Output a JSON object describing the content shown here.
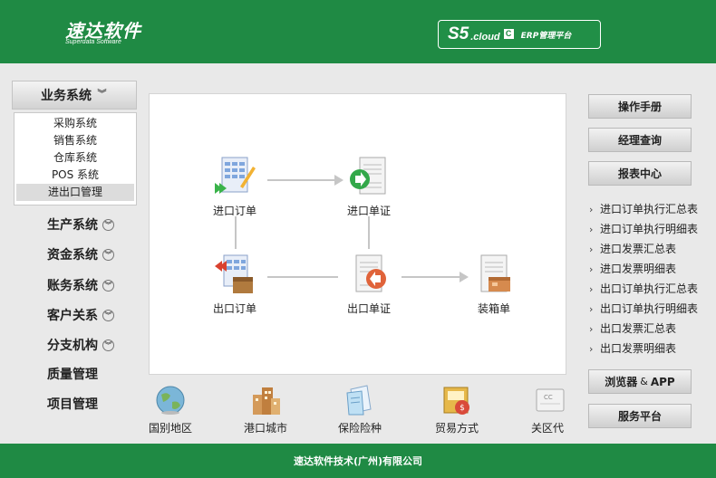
{
  "header": {
    "logo_main": "速达软件",
    "logo_sub": "Superdata Software",
    "badge_s5": "S5",
    "badge_cloud": ".cloud",
    "badge_c": "C",
    "badge_erp": "ERP管理平台"
  },
  "sidebar": {
    "business_system": "业务系统",
    "submenu": [
      "采购系统",
      "销售系统",
      "仓库系统",
      "POS 系统",
      "进出口管理"
    ],
    "items": [
      {
        "label": "生产系统",
        "chevron": true
      },
      {
        "label": "资金系统",
        "chevron": true
      },
      {
        "label": "账务系统",
        "chevron": true
      },
      {
        "label": "客户关系",
        "chevron": true
      },
      {
        "label": "分支机构",
        "chevron": true
      },
      {
        "label": "质量管理",
        "chevron": false
      },
      {
        "label": "项目管理",
        "chevron": false
      }
    ]
  },
  "flow": {
    "import_order": "进口订单",
    "import_doc": "进口单证",
    "export_order": "出口订单",
    "export_doc": "出口单证",
    "packing_list": "装箱单"
  },
  "quick": [
    "国别地区",
    "港口城市",
    "保险险种",
    "贸易方式",
    "关区代"
  ],
  "right": {
    "manual": "操作手册",
    "manager_query": "经理查询",
    "report_center": "报表中心",
    "reports": [
      "进口订单执行汇总表",
      "进口订单执行明细表",
      "进口发票汇总表",
      "进口发票明细表",
      "出口订单执行汇总表",
      "出口订单执行明细表",
      "出口发票汇总表",
      "出口发票明细表"
    ],
    "browser": "浏览器",
    "amp": "&",
    "app": "APP",
    "service": "服务平台"
  },
  "footer": {
    "company": "速达软件技术(广州)有限公司"
  },
  "colors": {
    "brand_green": "#1f8a44",
    "panel_bg": "#ffffff",
    "page_bg": "#e9e9e9"
  }
}
